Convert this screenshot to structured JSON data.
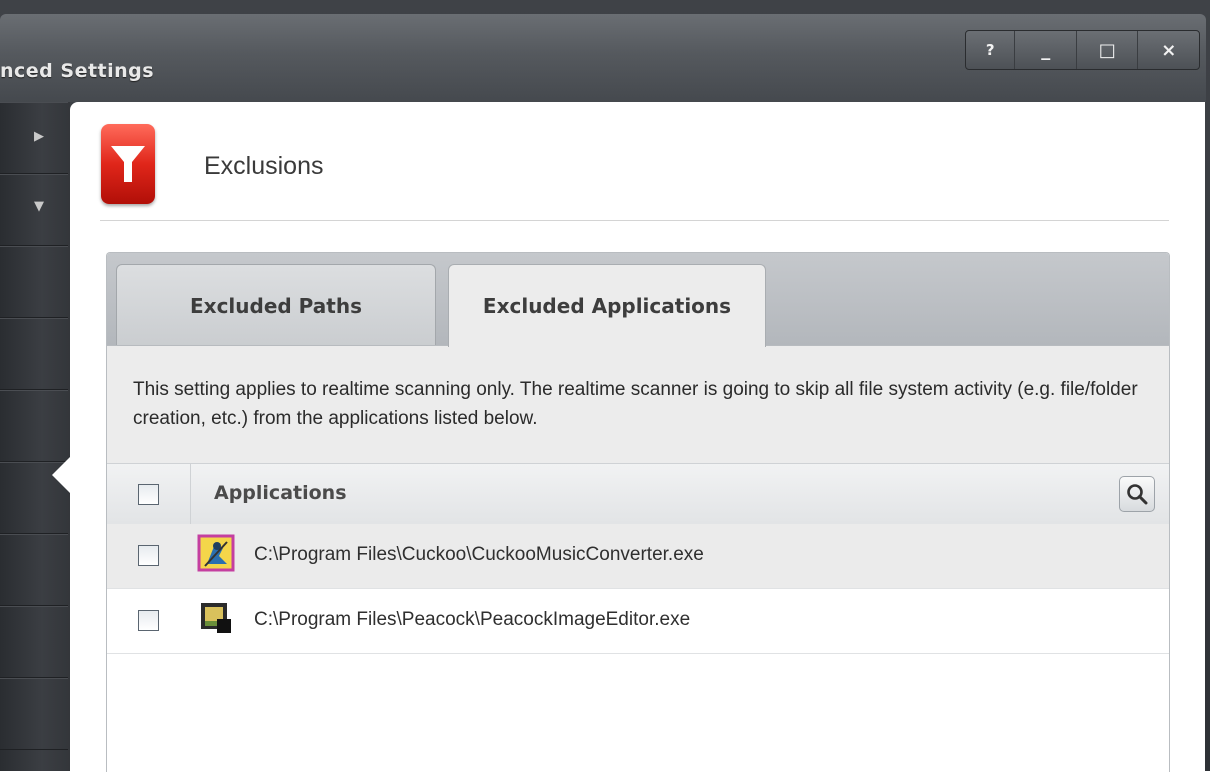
{
  "window": {
    "title": "nced Settings",
    "controls": [
      "?",
      "_",
      "□",
      "×"
    ]
  },
  "sidebar": {
    "arrows": [
      "▶",
      "▼"
    ]
  },
  "header": {
    "title": "Exclusions",
    "icon": "filter-icon"
  },
  "tabs": [
    {
      "label": "Excluded Paths",
      "active": false
    },
    {
      "label": "Excluded Applications",
      "active": true
    }
  ],
  "info": {
    "text": "This setting applies to realtime scanning only. The realtime scanner is going to skip all file system activity (e.g. file/folder creation, etc.) from the applications listed below."
  },
  "table": {
    "column": "Applications",
    "search_icon": "search-icon",
    "rows": [
      {
        "path": "C:\\Program Files\\Cuckoo\\CuckooMusicConverter.exe",
        "icon": "cuckoo-app-icon"
      },
      {
        "path": "C:\\Program Files\\Peacock\\PeacockImageEditor.exe",
        "icon": "peacock-app-icon"
      }
    ]
  },
  "colors": {
    "accent_red": "#e0261a",
    "titlebar": "#55595e"
  }
}
